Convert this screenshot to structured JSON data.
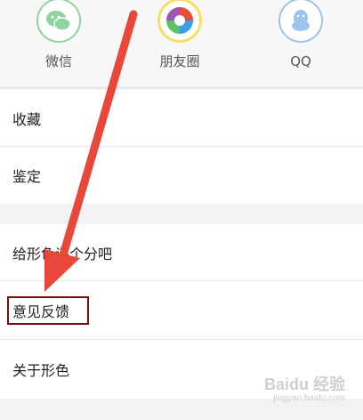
{
  "share": {
    "items": [
      {
        "label": "微信",
        "icon": "wechat-icon",
        "color": "#8fd39f"
      },
      {
        "label": "朋友圈",
        "icon": "moments-icon",
        "color": "#f2e06a"
      },
      {
        "label": "QQ",
        "icon": "qq-icon",
        "color": "#9cc4ee"
      }
    ]
  },
  "menu": {
    "group1": [
      "收藏",
      "鉴定"
    ],
    "group2": [
      "给形色评个分吧",
      "意见反馈",
      "关于形色"
    ]
  },
  "annotation": {
    "arrow_color": "#e8473a",
    "box_color": "#7a0f0f"
  },
  "watermark": {
    "main": "Baidu 经验",
    "sub": "jingyan.baidu.com"
  }
}
